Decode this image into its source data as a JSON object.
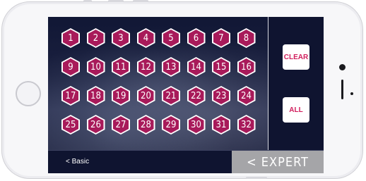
{
  "grid": {
    "buttons": [
      "1",
      "2",
      "3",
      "4",
      "5",
      "6",
      "7",
      "8",
      "9",
      "10",
      "11",
      "12",
      "13",
      "14",
      "15",
      "16",
      "17",
      "18",
      "19",
      "20",
      "21",
      "22",
      "23",
      "24",
      "25",
      "26",
      "27",
      "28",
      "29",
      "30",
      "31",
      "32"
    ]
  },
  "actions": {
    "clear_label": "CLEAR",
    "all_label": "ALL"
  },
  "bottom_bar": {
    "basic_label": "<  Basic",
    "expert_label": "<  EXPERT"
  },
  "colors": {
    "hex_fill": "#a81a5a",
    "hex_border": "#ffffff",
    "accent_text": "#d11e5d",
    "screen_bg": "#0f1430",
    "expert_bg": "#a5a5a8"
  }
}
